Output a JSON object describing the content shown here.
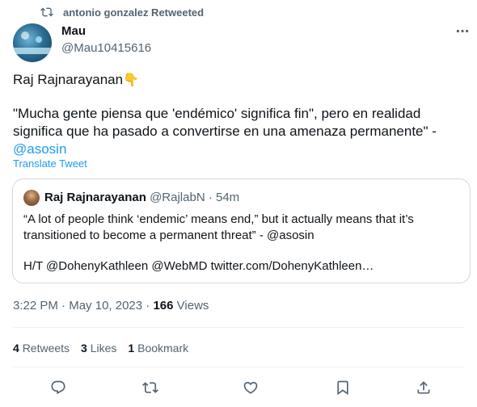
{
  "retweet_banner": {
    "text": "antonio gonzalez Retweeted",
    "icon": "retweet-icon"
  },
  "author": {
    "name": "Mau",
    "handle": "@Mau10415616"
  },
  "tweet": {
    "line1": "Raj Rajnarayanan",
    "line1_emoji": "👇",
    "body": "\"Mucha gente piensa que 'endémico' significa fin\", pero en realidad significa que ha pasado a convertirse en una amenaza permanente\" - ",
    "mention": "@asosin"
  },
  "translate_label": "Translate Tweet",
  "quoted": {
    "name": "Raj Rajnarayanan",
    "handle": "@RajlabN",
    "separator": "·",
    "time": "54m",
    "text1": "“A lot of people think ‘endemic’ means end,” but it actually means that it’s transitioned to become a permanent threat” - @asosin",
    "text2": "H/T @DohenyKathleen  @WebMD twitter.com/DohenyKathleen…"
  },
  "meta": {
    "time": "3:22 PM",
    "dot1": "·",
    "date": "May 10, 2023",
    "dot2": "·",
    "views": "166",
    "views_label": "Views"
  },
  "stats": {
    "retweets": "4",
    "retweets_label": "Retweets",
    "likes": "3",
    "likes_label": "Likes",
    "bookmarks": "1",
    "bookmarks_label": "Bookmark"
  },
  "actions": [
    "reply-icon",
    "retweet-icon",
    "like-icon",
    "share-icon"
  ],
  "colors": {
    "link": "#1d9bf0",
    "muted": "#536471",
    "text": "#0f1419",
    "border": "#cfd9de"
  }
}
